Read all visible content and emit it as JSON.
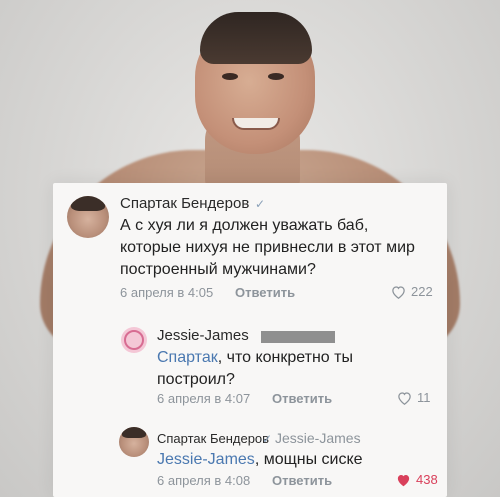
{
  "comments": [
    {
      "author": "Спартак Бендеров",
      "verified_mark": "✓",
      "text_lines": [
        "А с хуя ли я должен уважать баб,",
        "которые нихуя не привнесли в этот мир",
        "построенный мужчинами?"
      ],
      "date": "6 апреля в 4:05",
      "reply_label": "Ответить",
      "likes": "222"
    },
    {
      "author": "Jessie-James",
      "mention": "Спартак",
      "text_lines": [
        ", что конкретно ты",
        "построил?"
      ],
      "date": "6 апреля в 4:07",
      "reply_label": "Ответить",
      "likes": "11"
    },
    {
      "author": "Спартак Бендеров",
      "verified_mark": "✓",
      "reply_to": "Jessie-James",
      "mention": "Jessie-James",
      "text_after_mention": ", мощны сиске",
      "date": "6 апреля в 4:08",
      "reply_label": "Ответить",
      "likes": "438"
    }
  ],
  "colors": {
    "link": "#4a78b0",
    "meta": "#8d949b",
    "liked_heart": "#d9405b"
  }
}
